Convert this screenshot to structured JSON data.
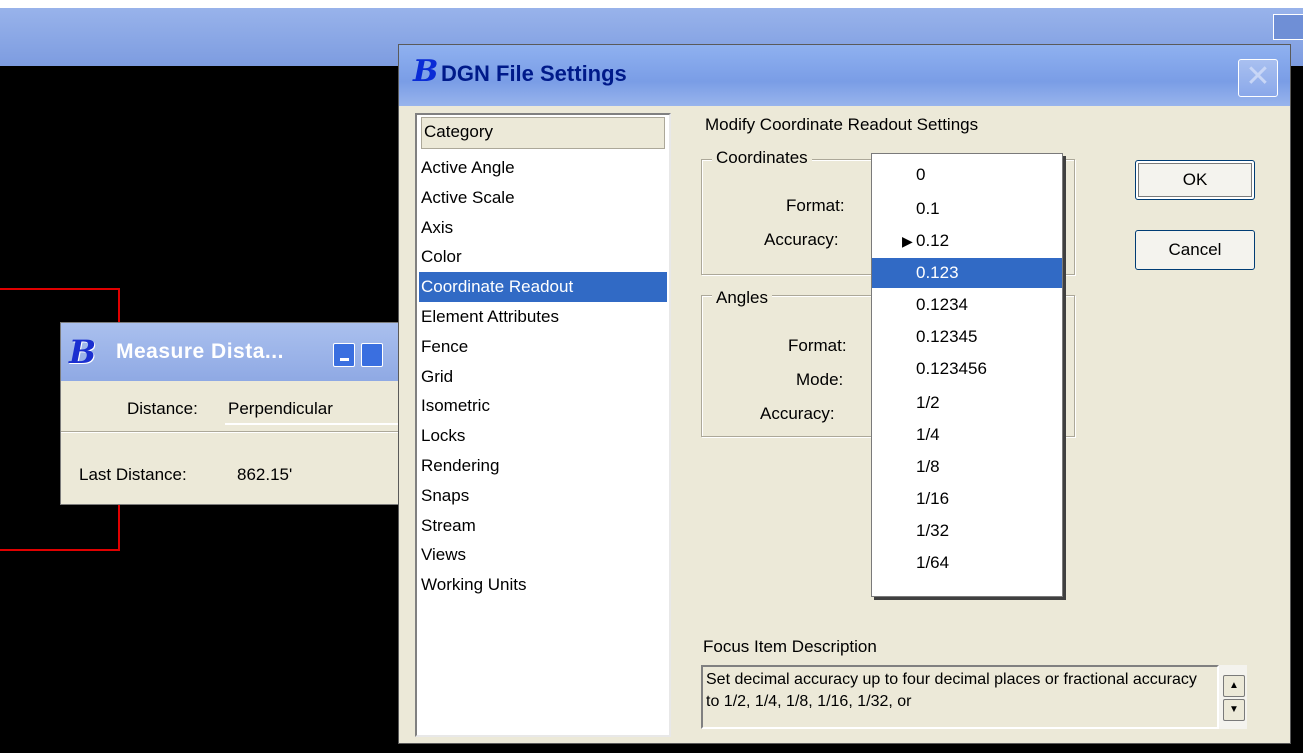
{
  "colors": {
    "accent": "#316ac5",
    "titlebar": "#7a9de6",
    "dialog_bg": "#ece9d8",
    "cad_line": "#e00000"
  },
  "measure_dialog": {
    "title": "Measure Dista...",
    "logo_letter": "B",
    "distance_label": "Distance:",
    "distance_value": "Perpendicular",
    "last_distance_label": "Last Distance:",
    "last_distance_value": "862.15'"
  },
  "dgn_dialog": {
    "title": "DGN File Settings",
    "logo_letter": "B",
    "close_icon": "close-icon",
    "category_header": "Category",
    "categories": [
      "Active Angle",
      "Active Scale",
      "Axis",
      "Color",
      "Coordinate Readout",
      "Element Attributes",
      "Fence",
      "Grid",
      "Isometric",
      "Locks",
      "Rendering",
      "Snaps",
      "Stream",
      "Views",
      "Working Units"
    ],
    "selected_category": "Coordinate Readout",
    "section_heading": "Modify Coordinate Readout Settings",
    "coordinates": {
      "legend": "Coordinates",
      "format_label": "Format:",
      "accuracy_label": "Accuracy:"
    },
    "angles": {
      "legend": "Angles",
      "format_label": "Format:",
      "mode_label": "Mode:",
      "accuracy_label": "Accuracy:"
    },
    "ok_button": "OK",
    "cancel_button": "Cancel",
    "accuracy_options": [
      "0",
      "0.1",
      "0.12",
      "0.123",
      "0.1234",
      "0.12345",
      "0.123456",
      "1/2",
      "1/4",
      "1/8",
      "1/16",
      "1/32",
      "1/64"
    ],
    "accuracy_highlighted": "0.123",
    "accuracy_current": "0.12",
    "focus_label": "Focus Item Description",
    "focus_text": "Set decimal accuracy up to four decimal places or fractional accuracy to 1/2, 1/4, 1/8, 1/16, 1/32, or"
  }
}
